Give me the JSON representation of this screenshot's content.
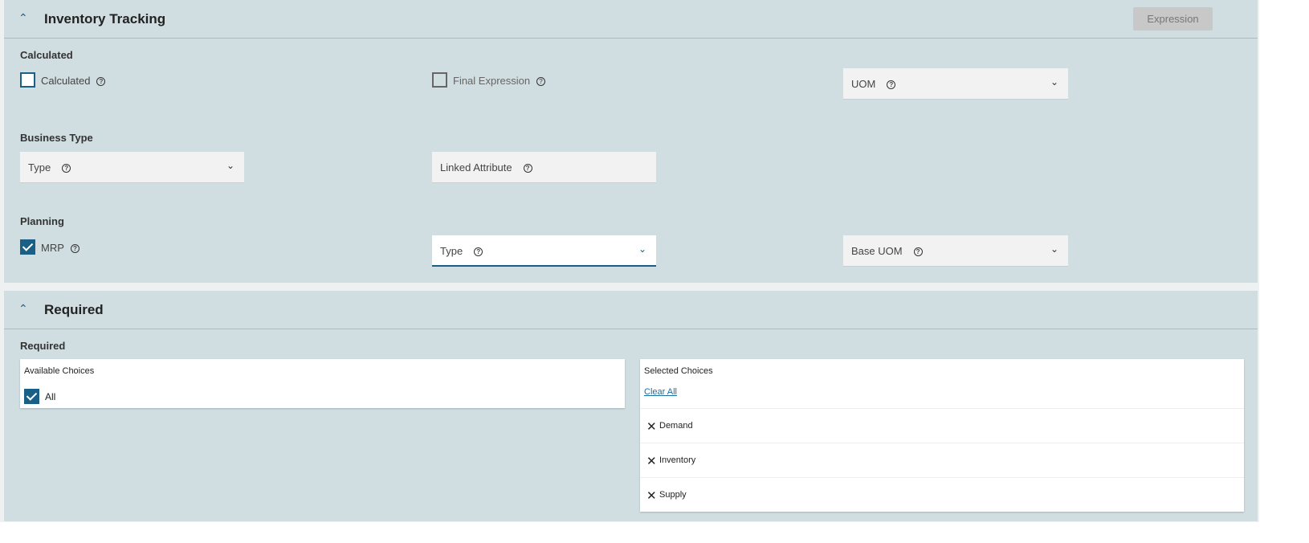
{
  "inventory": {
    "title": "Inventory Tracking",
    "expression_button": "Expression",
    "calculated_group": "Calculated",
    "calculated_label": "Calculated",
    "final_expression_label": "Final Expression",
    "uom_label": "UOM",
    "business_type_group": "Business Type",
    "type_label": "Type",
    "linked_attribute_label": "Linked Attribute",
    "planning_group": "Planning",
    "mrp_label": "MRP",
    "planning_type_label": "Type",
    "base_uom_label": "Base UOM"
  },
  "required": {
    "title": "Required",
    "group": "Required",
    "available_title": "Available Choices",
    "all_label": "All",
    "selected_title": "Selected Choices",
    "clear_all": "Clear All",
    "selected": [
      {
        "label": "Demand"
      },
      {
        "label": "Inventory"
      },
      {
        "label": "Supply"
      }
    ]
  }
}
